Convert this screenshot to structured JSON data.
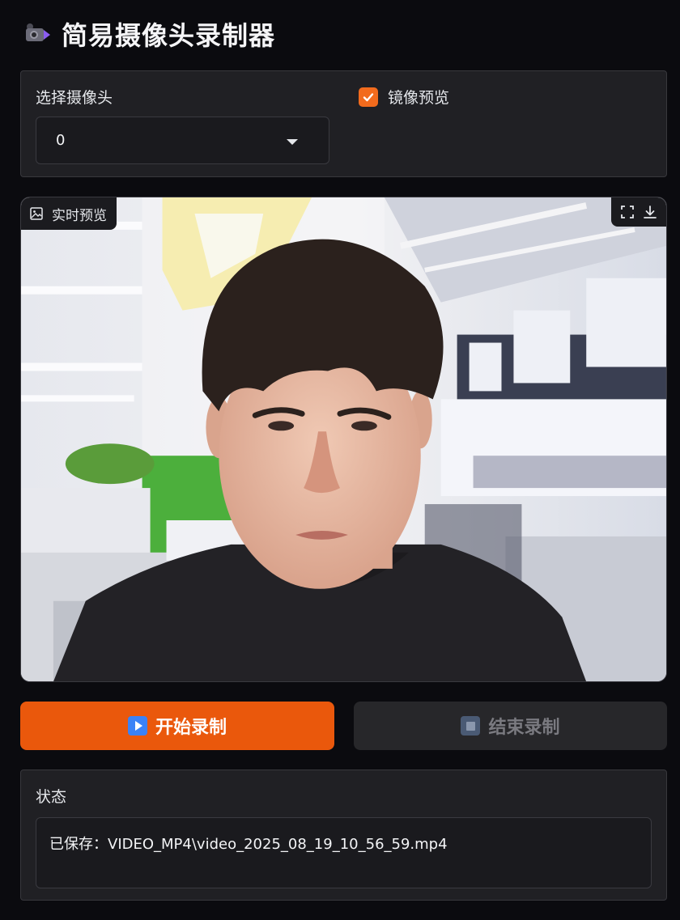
{
  "app": {
    "title": "简易摄像头录制器",
    "title_icon": "movie-camera-icon"
  },
  "settings": {
    "camera_select_label": "选择摄像头",
    "camera_select_value": "0",
    "mirror_label": "镜像预览",
    "mirror_checked": true
  },
  "video": {
    "badge_label": "实时预览",
    "badge_icon": "image-icon",
    "tools": [
      "fullscreen-icon",
      "download-icon"
    ]
  },
  "buttons": {
    "start_label": "开始录制",
    "start_icon": "play-button-icon",
    "stop_label": "结束录制",
    "stop_icon": "stop-button-icon"
  },
  "status": {
    "label": "状态",
    "value": "已保存：VIDEO_MP4\\video_2025_08_19_10_56_59.mp4"
  },
  "colors": {
    "accent": "#ea580c",
    "checkbox": "#f26b1d",
    "background": "#0b0b0f",
    "panel": "#202024"
  }
}
